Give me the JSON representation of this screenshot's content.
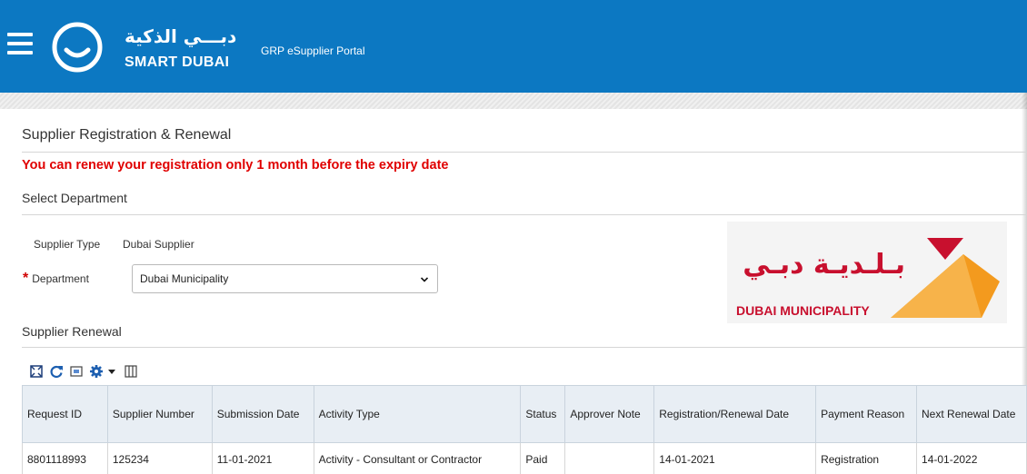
{
  "header": {
    "logo_arabic": "دبـــي الذكية",
    "logo_english": "SMART DUBAI",
    "portal_title": "GRP eSupplier Portal"
  },
  "page": {
    "title": "Supplier Registration & Renewal",
    "warning": "You can renew your registration only 1 month before the expiry date"
  },
  "department_section": {
    "title": "Select Department",
    "supplier_type_label": "Supplier Type",
    "supplier_type_value": "Dubai Supplier",
    "department_label": "Department",
    "department_value": "Dubai Municipality"
  },
  "dm_logo": {
    "arabic": "بـلـديـة دبـي",
    "english": "DUBAI MUNICIPALITY"
  },
  "renewal_section": {
    "title": "Supplier Renewal"
  },
  "toolbar": {
    "icons": [
      "detach-icon",
      "refresh-icon",
      "freeze-icon",
      "settings-icon",
      "dropdown-arrow-icon",
      "columns-icon"
    ]
  },
  "table": {
    "columns": [
      "Request ID",
      "Supplier Number",
      "Submission Date",
      "Activity Type",
      "Status",
      "Approver Note",
      "Registration/Renewal Date",
      "Payment Reason",
      "Next Renewal Date"
    ],
    "rows": [
      [
        "8801118993",
        "125234",
        "11-01-2021",
        "Activity - Consultant or Contractor",
        "Paid",
        "",
        "14-01-2021",
        "Registration",
        "14-01-2022"
      ]
    ]
  },
  "colors": {
    "header_blue": "#0c78c2",
    "warning_red": "#e00000",
    "dm_red": "#c8102e",
    "dm_orange": "#f39a1e"
  }
}
